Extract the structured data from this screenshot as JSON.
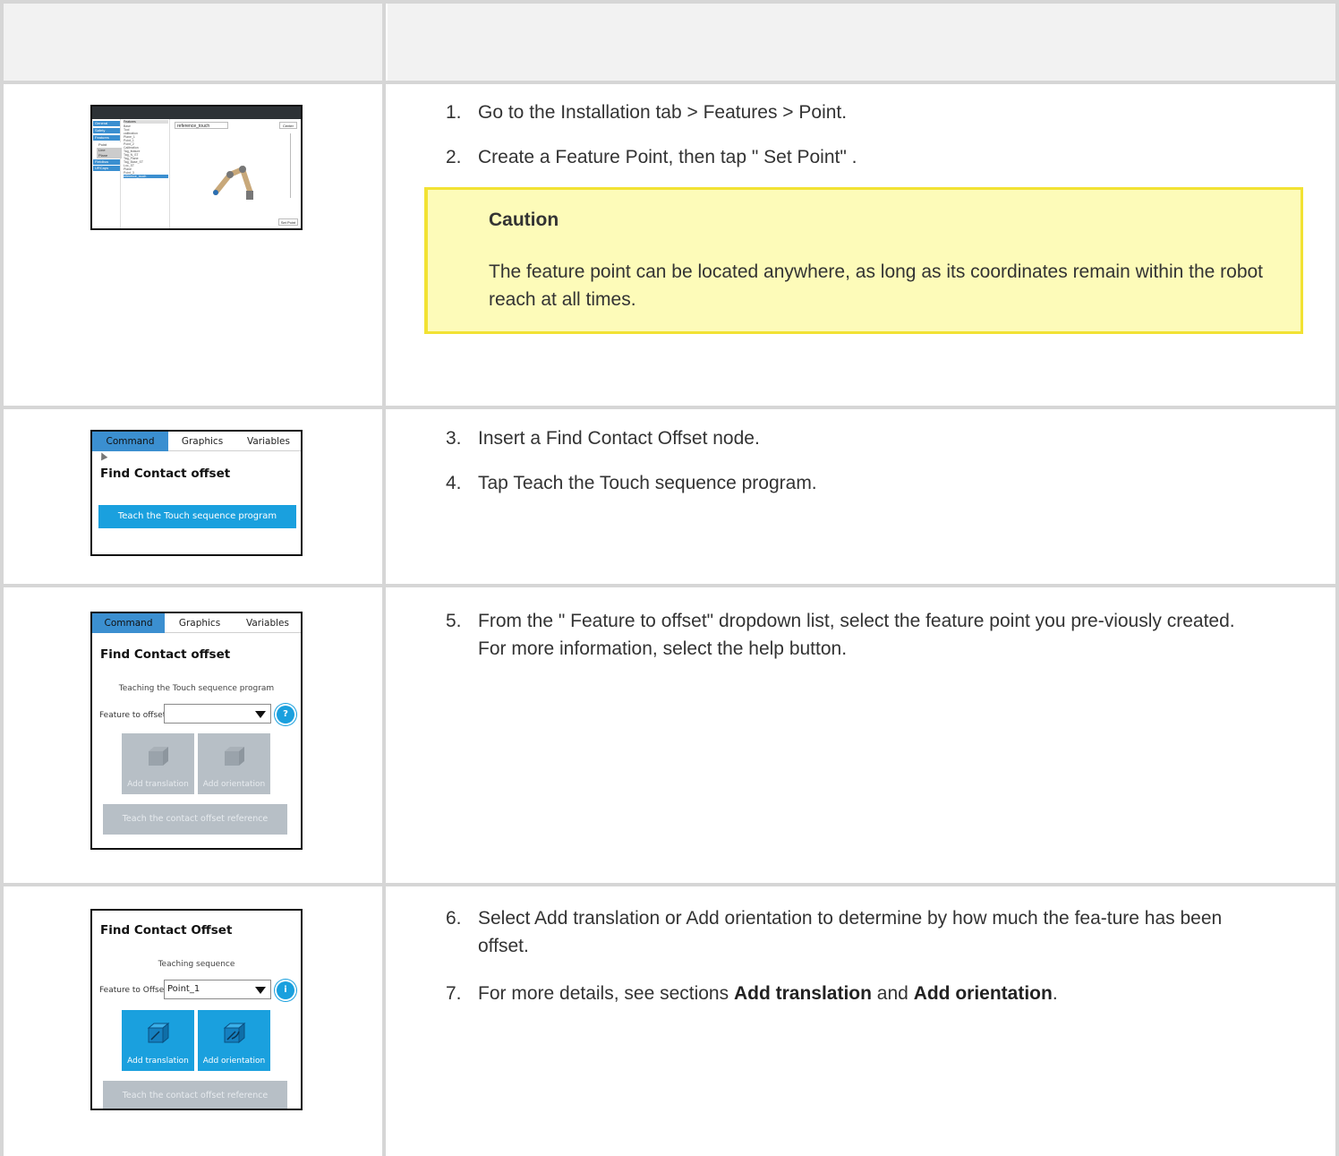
{
  "rows": [
    {
      "steps": [
        {
          "num": "1.",
          "parts": [
            {
              "t": "Go to the Installation tab > Features > Point.",
              "b": false
            }
          ]
        },
        {
          "num": "2.",
          "parts": [
            {
              "t": "Create a Feature Point, then tap \" Set Point\" .",
              "b": false
            }
          ]
        }
      ],
      "caution": {
        "title": "Caution",
        "body": "The feature point can be located anywhere, as long as its coordinates remain within the robot reach at all times."
      },
      "screenshot": {
        "title": "reference_touch",
        "set_point_label": "Set Point",
        "center_label": "Center",
        "sidebar": [
          "General",
          "Safety",
          "Features",
          "Point",
          "Line",
          "Plane",
          "Fieldbus",
          "URCaps"
        ],
        "tree_header": "Features",
        "tree": [
          "Base",
          "Tool",
          "calibration",
          "Plane_1",
          "Point_1",
          "Point_2",
          "Calibration",
          "Tag_feature",
          "Tag_N_ST",
          "Tag_Plane",
          "Tag_Base_ST",
          "Loc_ST",
          "Plane",
          "Point_3",
          "reference_touch"
        ]
      }
    },
    {
      "steps": [
        {
          "num": "3.",
          "parts": [
            {
              "t": "Insert a Find Contact Offset node.",
              "b": false
            }
          ]
        },
        {
          "num": "4.",
          "parts": [
            {
              "t": "Tap Teach the Touch sequence program.",
              "b": false
            }
          ]
        }
      ],
      "screenshot": {
        "tabs": [
          "Command",
          "Graphics",
          "Variables"
        ],
        "heading": "Find Contact offset",
        "button": "Teach the Touch sequence program"
      }
    },
    {
      "steps": [
        {
          "num": "5.",
          "parts": [
            {
              "t": "From the \" Feature to offset\" dropdown list, select the feature point you pre-viously created. For more information, select the help button.",
              "b": false
            }
          ]
        }
      ],
      "screenshot": {
        "tabs": [
          "Command",
          "Graphics",
          "Variables"
        ],
        "heading": "Find Contact offset",
        "subtitle": "Teaching the Touch sequence program",
        "feature_label": "Feature to offset:",
        "feature_value": "",
        "help": "?",
        "add_translation": "Add translation",
        "add_orientation": "Add orientation",
        "teach_reference": "Teach the contact offset reference"
      }
    },
    {
      "steps": [
        {
          "num": "6.",
          "parts": [
            {
              "t": "Select Add translation or Add orientation to determine by how much the fea-ture has been offset.",
              "b": false
            }
          ]
        },
        {
          "num": "7.",
          "parts": [
            {
              "t": "For more details, see sections ",
              "b": false
            },
            {
              "t": "Add translation",
              "b": true
            },
            {
              "t": " and ",
              "b": false
            },
            {
              "t": "Add orientation",
              "b": true
            },
            {
              "t": ".",
              "b": false
            }
          ]
        }
      ],
      "screenshot": {
        "heading": "Find Contact Offset",
        "subtitle": "Teaching sequence",
        "feature_label": "Feature to Offset",
        "feature_value": "Point_1",
        "help": "i",
        "add_translation": "Add translation",
        "add_orientation": "Add orientation",
        "teach_reference": "Teach the contact offset reference"
      }
    }
  ],
  "colors": {
    "caution_bg": "#fdfbb9",
    "caution_border": "#f2e233",
    "accent": "#1aa0de",
    "tab_active": "#3b8fd0",
    "disabled": "#b7bfc6"
  }
}
